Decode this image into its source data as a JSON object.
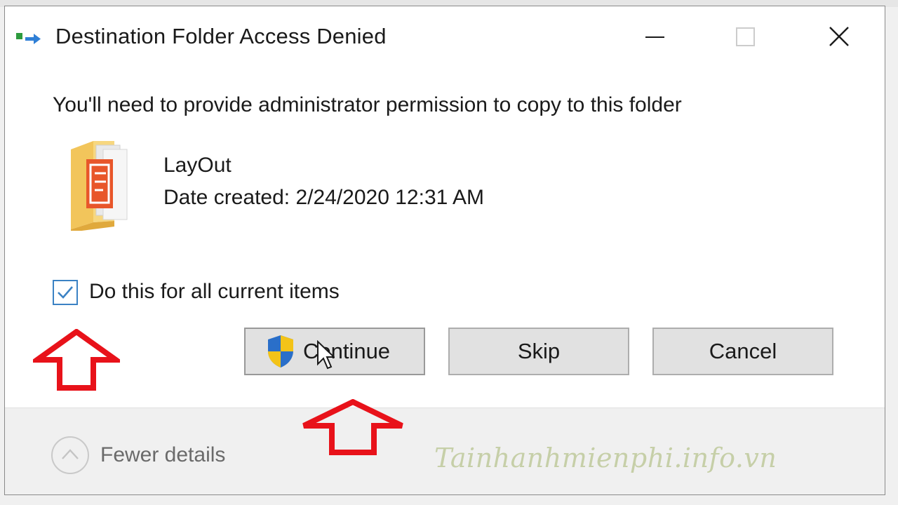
{
  "dialog": {
    "title": "Destination Folder Access Denied",
    "message": "You'll need to provide administrator permission to copy to this folder",
    "window_controls": {
      "minimize_icon": "minimize-icon",
      "maximize_icon": "maximize-icon",
      "close_icon": "close-icon"
    }
  },
  "file": {
    "icon": "folder-icon",
    "name": "LayOut",
    "date_created": "Date created: 2/24/2020 12:31 AM"
  },
  "option": {
    "label": "Do this for all current items",
    "checked": true
  },
  "buttons": {
    "continue_label": "Continue",
    "continue_icon": "uac-shield-icon",
    "skip_label": "Skip",
    "cancel_label": "Cancel"
  },
  "footer": {
    "toggle_icon": "chevron-up-icon",
    "fewer_details_label": "Fewer details"
  },
  "annotations": {
    "arrow_color": "#e8121a"
  },
  "watermark": "Tainhanhmienphi.info.vn",
  "colors": {
    "button_face": "#e1e1e1",
    "checkbox_accent": "#3b82c4",
    "footer_bg": "#f0f0f0"
  }
}
